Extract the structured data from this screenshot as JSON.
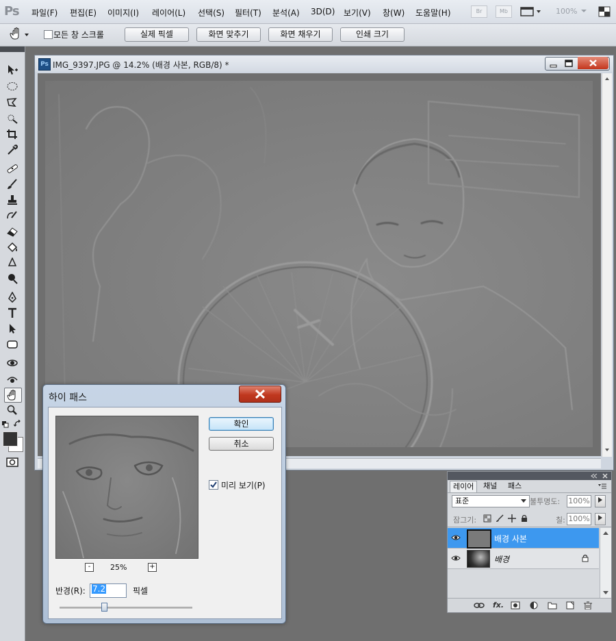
{
  "app": {
    "logo": "Ps",
    "menu": [
      "파일(F)",
      "편집(E)",
      "이미지(I)",
      "레이어(L)",
      "선택(S)",
      "필터(T)",
      "분석(A)",
      "3D(D)",
      "보기(V)",
      "창(W)",
      "도움말(H)"
    ],
    "toolbar_right": {
      "br": "Br",
      "mb": "Mb",
      "zoom": "100%"
    }
  },
  "options": {
    "scroll_all_windows": "모든 창 스크롤",
    "scroll_all_checked": false,
    "buttons": [
      "실제 픽셀",
      "화면 맞추기",
      "화면 채우기",
      "인쇄 크기"
    ]
  },
  "document": {
    "title": "IMG_9397.JPG @ 14.2% (배경 사본, RGB/8) *",
    "tab_icon": "Ps"
  },
  "dialog": {
    "title": "하이 패스",
    "ok": "확인",
    "cancel": "취소",
    "preview_label": "미리 보기(P)",
    "preview_checked": true,
    "zoom_level": "25%",
    "zoom_out": "-",
    "zoom_in": "+",
    "radius_label": "반경(R):",
    "radius_value": "7.2",
    "radius_unit": "픽셀",
    "slider_fraction": 0.34
  },
  "layers_panel": {
    "tabs": [
      "레이어",
      "채널",
      "패스"
    ],
    "blend_mode": "표준",
    "opacity_label": "불투명도:",
    "opacity": "100%",
    "lock_label": "잠그기:",
    "fill_label": "칠:",
    "fill": "100%",
    "layers": [
      {
        "name": "배경 사본",
        "selected": true,
        "locked": false
      },
      {
        "name": "배경",
        "selected": false,
        "locked": true
      }
    ]
  }
}
